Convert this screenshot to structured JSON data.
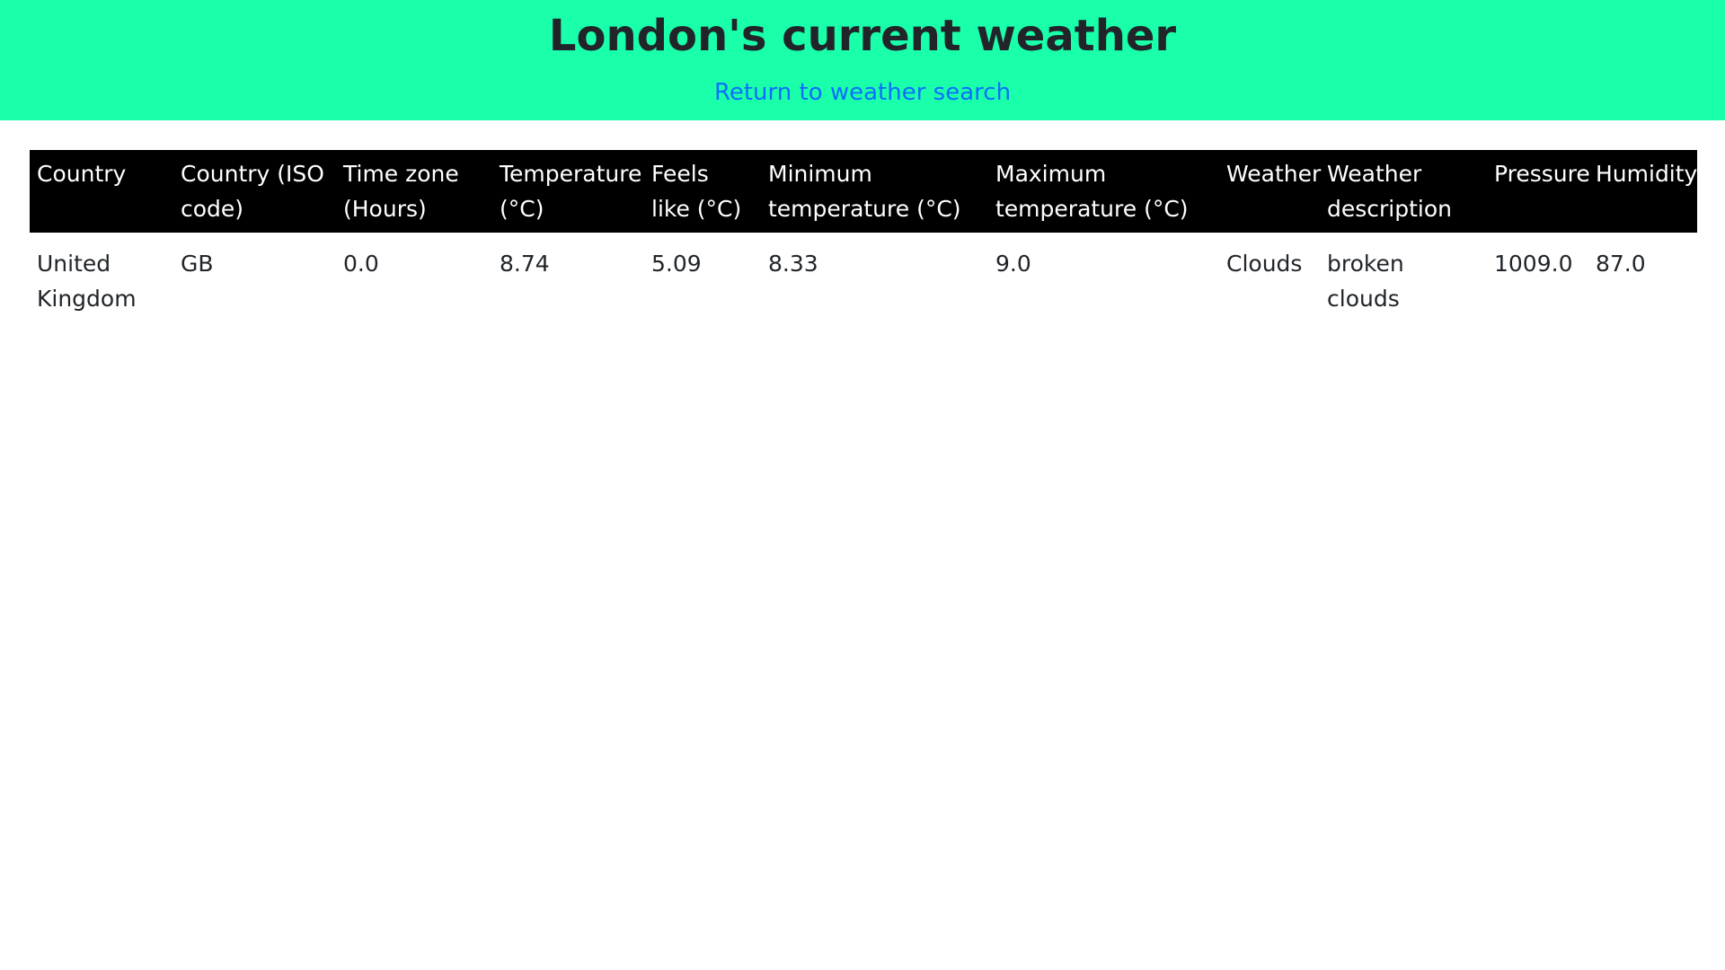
{
  "header": {
    "title": "London's current weather",
    "return_link": "Return to weather search"
  },
  "colors": {
    "header_background": "#19ffaa",
    "link": "#0d6efd",
    "table_header_background": "#000000",
    "table_header_text": "#ffffff"
  },
  "table": {
    "columns": [
      "Country",
      "Country (ISO code)",
      "Time zone (Hours)",
      "Temperature (°C)",
      "Feels like (°C)",
      "Minimum temperature (°C)",
      "Maximum temperature (°C)",
      "Weather",
      "Weather description",
      "Pressure",
      "Humidity"
    ],
    "rows": [
      [
        "United Kingdom",
        "GB",
        "0.0",
        "8.74",
        "5.09",
        "8.33",
        "9.0",
        "Clouds",
        "broken clouds",
        "1009.0",
        "87.0"
      ]
    ]
  }
}
